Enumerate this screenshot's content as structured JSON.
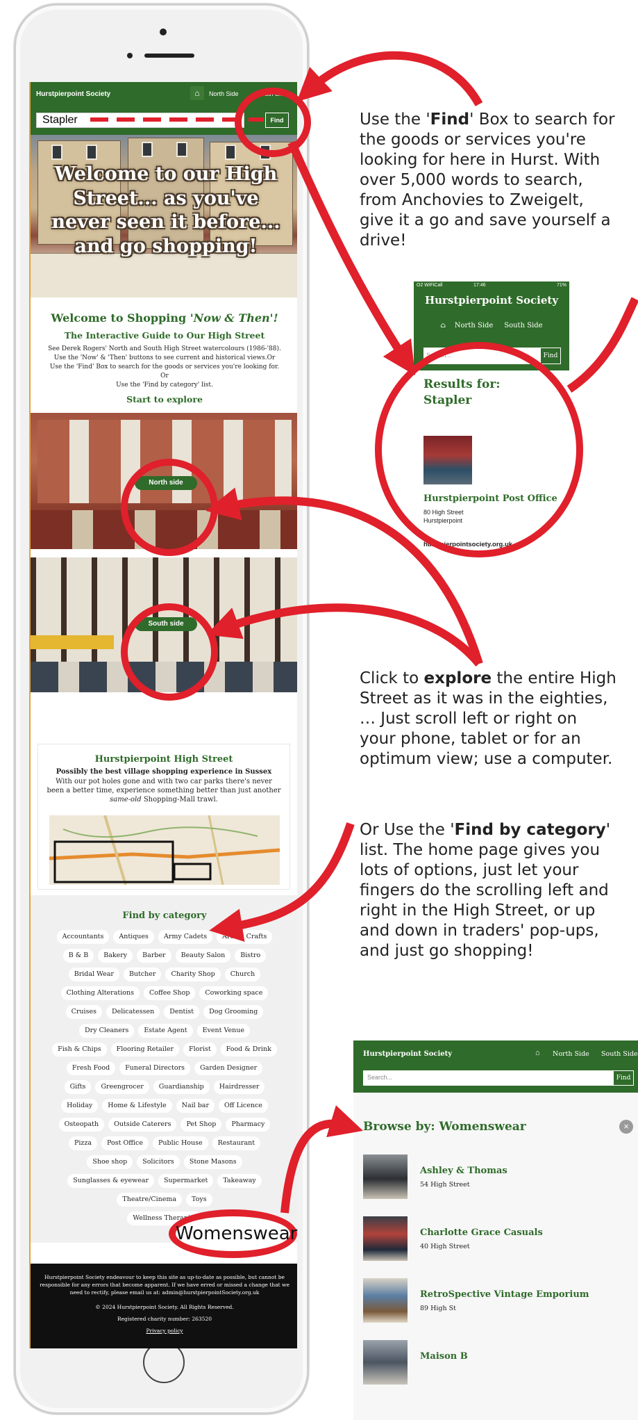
{
  "phone_site": {
    "site_title": "Hurstpierpoint Society",
    "nav": [
      "North Side",
      "South Side"
    ],
    "search_value": "Stapler",
    "find_label": "Find",
    "hero_text": "Welcome to our High Street... as you've never seen it before... and go shopping!",
    "welcome": {
      "title_prefix": "Welcome to Shopping ",
      "title_italic": "'Now & Then'!",
      "subtitle": "The Interactive Guide to Our High Street",
      "intro_line1": "See Derek Rogers' North and South High Street watercolours (1986-'88).",
      "intro_line2": "Use the 'Now' & 'Then' buttons to see current and historical views.Or",
      "intro_line3": "Use the 'Find' Box to search for the goods or services you're looking for.",
      "intro_line4": "Or",
      "intro_line5": "Use the 'Find by category' list.",
      "start": "Start to explore"
    },
    "north_button": "North side",
    "south_button": "South side",
    "info_card": {
      "title": "Hurstpierpoint High Street",
      "bold_line": "Possibly the best village shopping experience in Sussex",
      "text_prefix": "With our pot holes gone and with two car parks there's never been a better time, experience something better than just another ",
      "text_italic": "same-old",
      "text_suffix": " Shopping-Mall trawl."
    },
    "category_title": "Find by category",
    "category_rows": [
      [
        "Accountants",
        "Antiques",
        "Army Cadets",
        "Arts & Crafts"
      ],
      [
        "B & B",
        "Bakery",
        "Barber",
        "Beauty Salon",
        "Bistro"
      ],
      [
        "Bridal Wear",
        "Butcher",
        "Charity Shop",
        "Church"
      ],
      [
        "Clothing Alterations",
        "Coffee Shop",
        "Coworking space"
      ],
      [
        "Cruises",
        "Delicatessen",
        "Dentist",
        "Dog Grooming"
      ],
      [
        "Dry Cleaners",
        "Estate Agent",
        "Event Venue"
      ],
      [
        "Fish & Chips",
        "Flooring Retailer",
        "Florist",
        "Food & Drink"
      ],
      [
        "Fresh Food",
        "Funeral Directors",
        "Garden Designer"
      ],
      [
        "Gifts",
        "Greengrocer",
        "Guardianship",
        "Hairdresser"
      ],
      [
        "Holiday",
        "Home & Lifestyle",
        "Nail bar",
        "Off Licence"
      ],
      [
        "Osteopath",
        "Outside Caterers",
        "Pet Shop",
        "Pharmacy"
      ],
      [
        "Pizza",
        "Post Office",
        "Public House",
        "Restaurant"
      ],
      [
        "Shoe shop",
        "Solicitors",
        "Stone Masons"
      ],
      [
        "Sunglasses & eyewear",
        "Supermarket",
        "Takeaway"
      ],
      [
        "Theatre/Cinema",
        "Toys"
      ],
      [
        "Wellness Therapist"
      ]
    ],
    "womenswear_label": "Womenswear",
    "footer": {
      "disclaimer": "Hurstpierpoint Society endeavour to keep this site as up-to-date as possible, but cannot be responsible for any errors that become apparent. If we have erred or missed a change that we need to rectify, please email us at: admin@hurstpierpointSociety.org.uk",
      "copyright": "© 2024 Hurstpierpoint Society. All Rights Reserved.",
      "charity": "Registered charity number: 263520",
      "privacy": "Privacy policy"
    }
  },
  "notes": {
    "find_note": {
      "line1_pre": "Use the '",
      "line1_bold": "Find",
      "line1_post": "' Box to search for",
      "line2": "the goods or services you're",
      "line3": "looking for here in Hurst. With",
      "line4": "over 5,000 words to search,",
      "line5": "from Anchovies to Zweigelt,",
      "line6": "give it a go and save yourself a",
      "line7": "drive!"
    },
    "explore_note": {
      "line1_pre": "Click to ",
      "line1_bold": "explore",
      "line1_post": " the entire High",
      "line2": "Street as it was in the eighties,",
      "line3": "… Just scroll left or right on",
      "line4": "your phone, tablet or for an",
      "line5": "optimum view; use a computer."
    },
    "category_note": {
      "line1_pre": "Or Use the '",
      "line1_bold": "Find by category",
      "line1_post": "'",
      "line2": "list. The home page gives you",
      "line3": "lots of options, just let your",
      "line4": "fingers do the scrolling left and",
      "line5": "right in the High Street, or up",
      "line6": "and down in traders' pop-ups,",
      "line7": "and just go shopping!"
    }
  },
  "results_screen": {
    "carrier": "O2 WiFiCall",
    "time": "17:46",
    "battery": "71%",
    "title": "Hurstpierpoint Society",
    "nav": [
      "North Side",
      "South Side"
    ],
    "search_placeholder": "Search...",
    "find_label": "Find",
    "heading_line1": "Results for:",
    "heading_line2": "Stapler",
    "result_name": "Hurstpierpoint Post Office",
    "result_addr1": "80 High Street",
    "result_addr2": "Hurstpierpoint",
    "url": "hurstpierpointsociety.org.uk"
  },
  "browse_screen": {
    "title": "Hurstpierpoint Society",
    "nav": [
      "North Side",
      "South Side"
    ],
    "search_placeholder": "Search...",
    "find_label": "Find",
    "heading": "Browse by: Womenswear",
    "shops": [
      {
        "name": "Ashley & Thomas",
        "address": "54 High Street"
      },
      {
        "name": "Charlotte Grace Casuals",
        "address": "40 High Street"
      },
      {
        "name": "RetroSpective Vintage Emporium",
        "address": "89 High St"
      },
      {
        "name": "Maison B",
        "address": ""
      }
    ]
  },
  "colors": {
    "brand_green": "#2f6b2a",
    "annotation_red": "#e0202b",
    "footer_black": "#101010"
  }
}
